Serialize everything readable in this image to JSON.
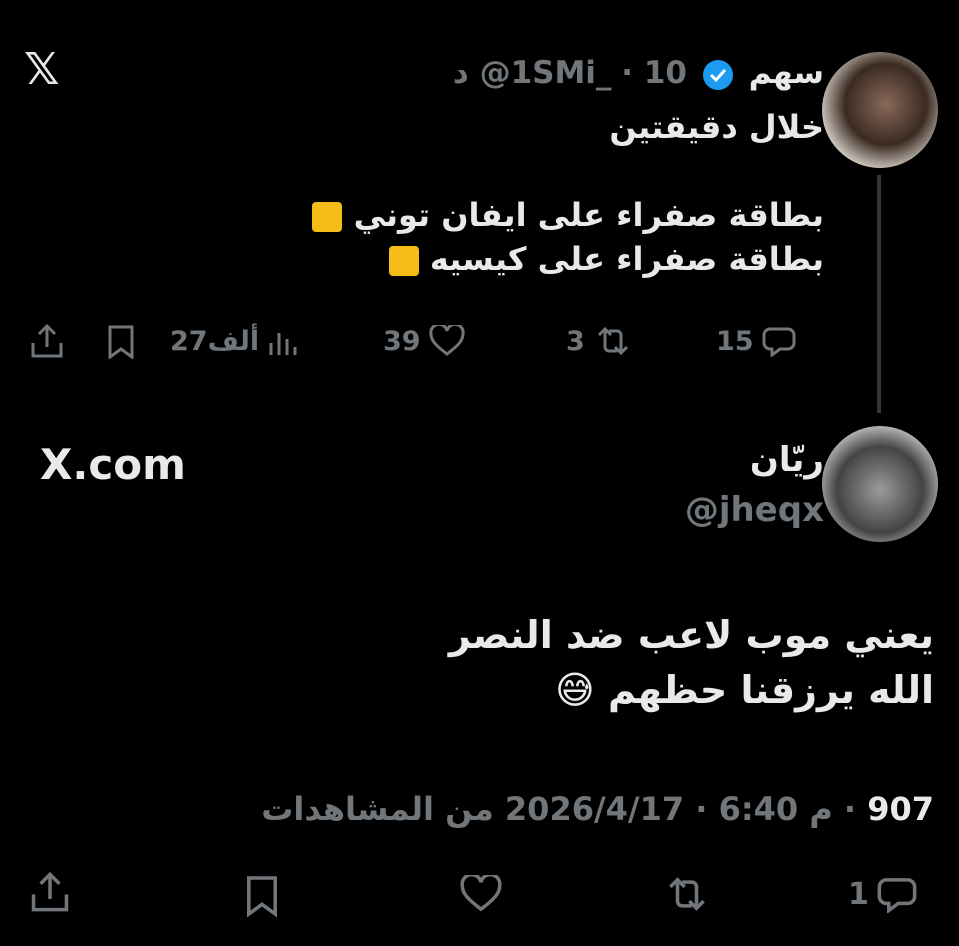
{
  "logo": {
    "icon": "x-logo-icon",
    "glyph": "𝕏"
  },
  "tweet1": {
    "name": "سهم",
    "handle": "@1SMi_",
    "time": "· 10 د",
    "lines": [
      "خلال دقيقتين",
      "",
      "بطاقة صفراء على ايفان توني",
      "بطاقة صفراء على كيسيه"
    ],
    "emoji": "yellow-square",
    "actions": {
      "replies": "15",
      "reposts": "3",
      "likes": "39",
      "views": "27ألف"
    }
  },
  "tweet2": {
    "site": "X.com",
    "name": "ريّان",
    "handle": "@jheqx",
    "lines": [
      "يعني موب لاعب ضد النصر",
      "الله يرزقنا حظهم 😅"
    ],
    "meta_date": "2026/4/17 · 6:40 م · ",
    "meta_views": "907",
    "meta_views_label": " من المشاهدات",
    "actions": {
      "replies": "1"
    }
  },
  "colors": {
    "background": "#000000",
    "text": "#e7e9ea",
    "muted": "#71767b",
    "verified": "#1d9bf0",
    "yellow_card": "#f4bd18"
  }
}
